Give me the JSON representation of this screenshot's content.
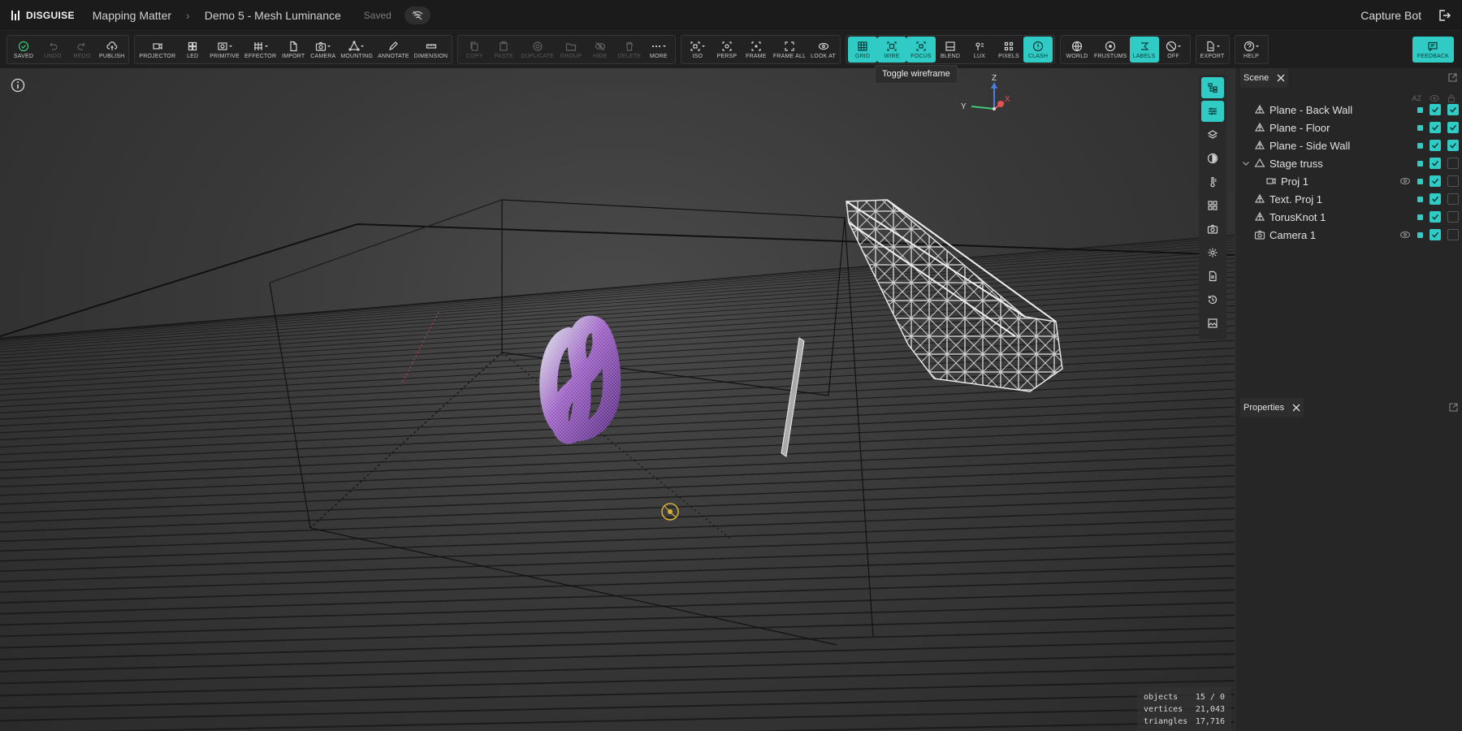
{
  "app": {
    "logo": "DISGUISE",
    "project": "Mapping Matter",
    "scene": "Demo 5 - Mesh Luminance",
    "save_status": "Saved",
    "user": "Capture Bot"
  },
  "toolbar": {
    "groups": [
      [
        {
          "label": "SAVED",
          "icon": "check-circle-icon",
          "state": "normal"
        },
        {
          "label": "UNDO",
          "icon": "undo-icon",
          "state": "disabled"
        },
        {
          "label": "REDO",
          "icon": "redo-icon",
          "state": "disabled"
        },
        {
          "label": "PUBLISH",
          "icon": "cloud-upload-icon",
          "state": "normal"
        }
      ],
      [
        {
          "label": "PROJECTOR",
          "icon": "projector-icon",
          "state": "normal"
        },
        {
          "label": "LED",
          "icon": "led-grid-icon",
          "state": "normal"
        },
        {
          "label": "PRIMITIVE",
          "icon": "primitive-icon",
          "state": "normal",
          "dropdown": true
        },
        {
          "label": "EFFECTOR",
          "icon": "effector-icon",
          "state": "normal",
          "dropdown": true
        },
        {
          "label": "IMPORT",
          "icon": "import-icon",
          "state": "normal"
        },
        {
          "label": "CAMERA",
          "icon": "camera-icon",
          "state": "normal",
          "dropdown": true
        },
        {
          "label": "MOUNTING",
          "icon": "mounting-icon",
          "state": "normal",
          "dropdown": true
        },
        {
          "label": "ANNOTATE",
          "icon": "pencil-icon",
          "state": "normal"
        },
        {
          "label": "DIMENSION",
          "icon": "ruler-icon",
          "state": "normal"
        }
      ],
      [
        {
          "label": "COPY",
          "icon": "copy-icon",
          "state": "disabled"
        },
        {
          "label": "PASTE",
          "icon": "paste-icon",
          "state": "disabled"
        },
        {
          "label": "DUPLICATE",
          "icon": "duplicate-icon",
          "state": "disabled"
        },
        {
          "label": "GROUP",
          "icon": "folder-icon",
          "state": "disabled"
        },
        {
          "label": "HIDE",
          "icon": "eye-off-icon",
          "state": "disabled"
        },
        {
          "label": "DELETE",
          "icon": "trash-icon",
          "state": "disabled"
        },
        {
          "label": "MORE",
          "icon": "more-icon",
          "state": "normal",
          "dropdown": true
        }
      ],
      [
        {
          "label": "ISO",
          "icon": "iso-icon",
          "state": "normal",
          "dropdown": true
        },
        {
          "label": "PERSP",
          "icon": "perspective-icon",
          "state": "normal"
        },
        {
          "label": "FRAME",
          "icon": "frame-icon",
          "state": "normal"
        },
        {
          "label": "FRAME ALL",
          "icon": "frame-all-icon",
          "state": "normal"
        },
        {
          "label": "LOOK AT",
          "icon": "look-at-icon",
          "state": "normal"
        }
      ],
      [
        {
          "label": "GRID",
          "icon": "grid-icon",
          "state": "on"
        },
        {
          "label": "WIRE",
          "icon": "wireframe-icon",
          "state": "on"
        },
        {
          "label": "FOCUS",
          "icon": "focus-icon",
          "state": "on"
        },
        {
          "label": "BLEND",
          "icon": "blend-icon",
          "state": "normal"
        },
        {
          "label": "LUX",
          "icon": "lux-icon",
          "state": "normal"
        },
        {
          "label": "PIXELS",
          "icon": "pixels-icon",
          "state": "normal"
        },
        {
          "label": "CLASH",
          "icon": "clash-icon",
          "state": "on"
        }
      ],
      [
        {
          "label": "WORLD",
          "icon": "globe-icon",
          "state": "normal"
        },
        {
          "label": "FRUSTUMS",
          "icon": "frustum-icon",
          "state": "normal"
        },
        {
          "label": "LABELS",
          "icon": "labels-icon",
          "state": "on"
        },
        {
          "label": "OFF",
          "icon": "off-icon",
          "state": "normal",
          "dropdown": true
        }
      ],
      [
        {
          "label": "EXPORT",
          "icon": "export-icon",
          "state": "normal",
          "dropdown": true
        }
      ],
      [
        {
          "label": "HELP",
          "icon": "help-icon",
          "state": "normal",
          "dropdown": true
        }
      ]
    ],
    "feedback": {
      "label": "FEEDBACK",
      "icon": "feedback-icon"
    }
  },
  "tooltip": "Toggle wireframe",
  "gizmo": {
    "z": "Z",
    "y": "Y",
    "x": "X"
  },
  "stats": {
    "objects_label": "objects",
    "objects_value": "15 / 0",
    "vertices_label": "vertices",
    "vertices_value": "21,043",
    "triangles_label": "triangles",
    "triangles_value": "17,716"
  },
  "side_tools": [
    {
      "icon": "scene-tree-icon",
      "on": true
    },
    {
      "icon": "sliders-icon",
      "on": true
    },
    {
      "icon": "layers-icon",
      "on": false
    },
    {
      "icon": "contrast-icon",
      "on": false
    },
    {
      "icon": "thermometer-icon",
      "on": false
    },
    {
      "icon": "grid-apps-icon",
      "on": false
    },
    {
      "icon": "camera-icon",
      "on": false
    },
    {
      "icon": "settings-icon",
      "on": false
    },
    {
      "icon": "document-icon",
      "on": false
    },
    {
      "icon": "history-icon",
      "on": false
    },
    {
      "icon": "image-icon",
      "on": false
    }
  ],
  "scene_panel": {
    "title": "Scene",
    "sort_label": "AZ",
    "items": [
      {
        "name": "Plane - Back Wall",
        "icon": "mesh-icon",
        "depth": 0,
        "expandable": false,
        "eye": false,
        "visible": true,
        "locked": true
      },
      {
        "name": "Plane - Floor",
        "icon": "mesh-icon",
        "depth": 0,
        "expandable": false,
        "eye": false,
        "visible": true,
        "locked": true
      },
      {
        "name": "Plane - Side Wall",
        "icon": "mesh-icon",
        "depth": 0,
        "expandable": false,
        "eye": false,
        "visible": true,
        "locked": true
      },
      {
        "name": "Stage truss",
        "icon": "truss-icon",
        "depth": 0,
        "expandable": true,
        "eye": false,
        "visible": true,
        "locked": false
      },
      {
        "name": "Proj 1",
        "icon": "projector-icon",
        "depth": 1,
        "expandable": false,
        "eye": true,
        "visible": true,
        "locked": false
      },
      {
        "name": "Text. Proj 1",
        "icon": "mesh-icon",
        "depth": 0,
        "expandable": false,
        "eye": false,
        "visible": true,
        "locked": false
      },
      {
        "name": "TorusKnot 1",
        "icon": "mesh-icon",
        "depth": 0,
        "expandable": false,
        "eye": false,
        "visible": true,
        "locked": false
      },
      {
        "name": "Camera 1",
        "icon": "camera-icon",
        "depth": 0,
        "expandable": false,
        "eye": true,
        "visible": true,
        "locked": false
      }
    ]
  },
  "properties_panel": {
    "title": "Properties"
  },
  "colors": {
    "accent": "#2fcbc4",
    "background": "#1d1d1d",
    "panel": "#262626"
  }
}
